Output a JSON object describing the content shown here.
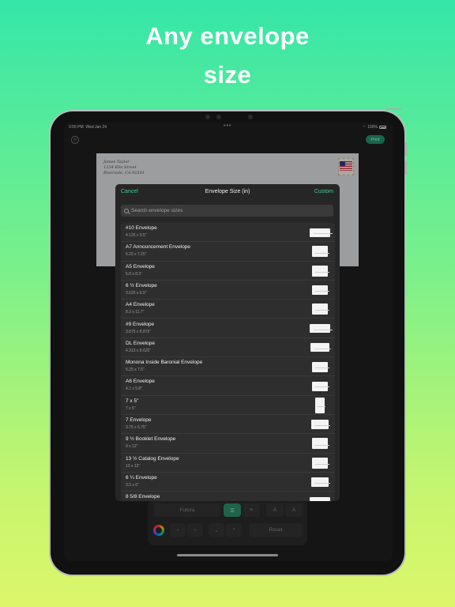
{
  "headline": {
    "line1": "Any envelope",
    "line2": "size"
  },
  "status_bar": {
    "time": "9:55 PM",
    "date": "Wed Jan 24",
    "battery": "100%"
  },
  "toolbar_top": {
    "print_label": "Print",
    "close_icon": "close-circle-icon"
  },
  "envelope_preview": {
    "return_address": [
      "James Taylor",
      "1234 Elm Street",
      "Riverside, CA 92501"
    ]
  },
  "modal": {
    "cancel_label": "Cancel",
    "title": "Envelope Size (in)",
    "custom_label": "Custom",
    "search_placeholder": "Search envelope sizes"
  },
  "envelopes": [
    {
      "name": "#10 Envelope",
      "size": "4.125 x 9.5\""
    },
    {
      "name": "A7 Announcement Envelope",
      "size": "5.25 x 7.25\""
    },
    {
      "name": "A5 Envelope",
      "size": "5.8 x 8.3\""
    },
    {
      "name": "6 ½ Envelope",
      "size": "3.625 x 6.5\""
    },
    {
      "name": "A4 Envelope",
      "size": "8.3 x 11.7\""
    },
    {
      "name": "#9 Envelope",
      "size": "3.875 x 8.875\""
    },
    {
      "name": "DL Envelope",
      "size": "4.313 x 8.625\""
    },
    {
      "name": "Monona Inside Baronial Envelope",
      "size": "5.25 x 7.5\""
    },
    {
      "name": "A6 Envelope",
      "size": "4.1 x 5.8\""
    },
    {
      "name": "7 x 5\"",
      "size": "7 x 5\""
    },
    {
      "name": "7 Envelope",
      "size": "3.75 x 6.75\""
    },
    {
      "name": "9 ½ Booklet Envelope",
      "size": "9 x 12\""
    },
    {
      "name": "13 ½ Catalog Envelope",
      "size": "10 x 13\""
    },
    {
      "name": "6 ¼ Envelope",
      "size": "3.5 x 6\""
    },
    {
      "name": "8 5/8 Envelope",
      "size": ""
    }
  ],
  "bottom_toolbar": {
    "font_name": "Futura",
    "reset_label": "Reset"
  },
  "colors": {
    "accent": "#3ecf94",
    "print_button": "#1f8f69",
    "active_align": "#2b8a65"
  }
}
